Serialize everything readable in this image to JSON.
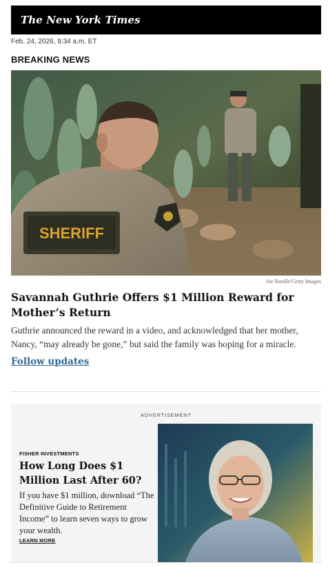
{
  "masthead": {
    "logo_text": "The New York Times"
  },
  "dateline": "Feb. 24, 2026, 9:34 a.m. ET",
  "section_label": "BREAKING NEWS",
  "hero": {
    "badge_text": "SHERIFF",
    "credit": "Joe Raedle/Getty Images"
  },
  "article": {
    "headline": "Savannah Guthrie Offers $1 Million Reward for Mother’s Return",
    "summary": "Guthrie announced the reward in a video, and acknowledged that her mother, Nancy, “may already be gone,” but said the family was hoping for a miracle.",
    "link_text": "Follow updates"
  },
  "ad": {
    "label": "ADVERTISEMENT",
    "brand": "FISHER INVESTMENTS",
    "title": "How Long Does $1 Million Last After 60?",
    "body": "If you have $1 million, download “The Definitive Guide to Retirement Income” to learn seven ways to grow your wealth.",
    "cta": "LEARN MORE"
  },
  "colors": {
    "link": "#326891",
    "masthead_bg": "#000000",
    "ad_bg": "#f4f4f4"
  }
}
